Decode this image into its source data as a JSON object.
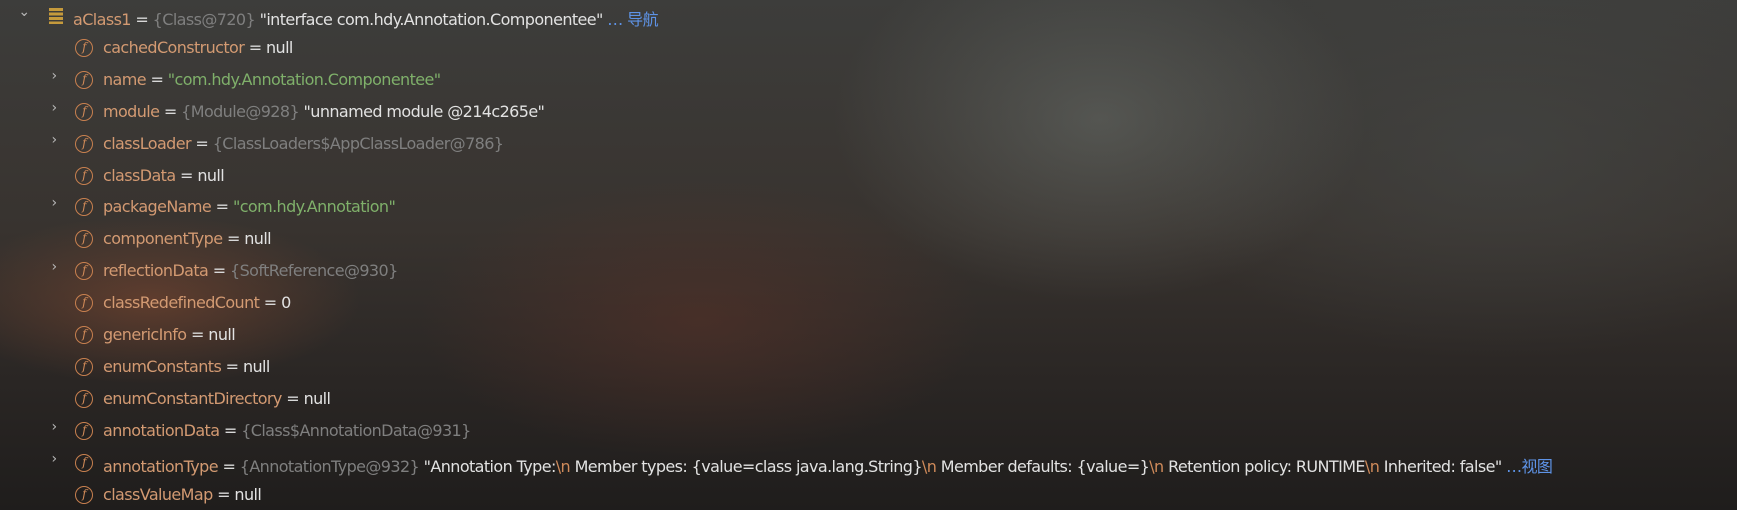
{
  "root": {
    "name": "aClass1",
    "type_ref": "{Class@720}",
    "value": "\"interface com.hdy.Annotation.Componentee\"",
    "link": "… 导航",
    "expanded": true,
    "icon": "static-field-stack-icon"
  },
  "fields": [
    {
      "name": "cachedConstructor",
      "expandable": false,
      "segments": [
        {
          "k": "plain",
          "t": "null"
        }
      ]
    },
    {
      "name": "name",
      "expandable": true,
      "segments": [
        {
          "k": "str",
          "t": "\"com.hdy.Annotation.Componentee\""
        }
      ]
    },
    {
      "name": "module",
      "expandable": true,
      "segments": [
        {
          "k": "ref",
          "t": "{Module@928}"
        },
        {
          "k": "plain",
          "t": " \"unnamed module @214c265e\""
        }
      ]
    },
    {
      "name": "classLoader",
      "expandable": true,
      "segments": [
        {
          "k": "ref",
          "t": "{ClassLoaders$AppClassLoader@786}"
        }
      ]
    },
    {
      "name": "classData",
      "expandable": false,
      "segments": [
        {
          "k": "plain",
          "t": "null"
        }
      ]
    },
    {
      "name": "packageName",
      "expandable": true,
      "segments": [
        {
          "k": "str",
          "t": "\"com.hdy.Annotation\""
        }
      ]
    },
    {
      "name": "componentType",
      "expandable": false,
      "segments": [
        {
          "k": "plain",
          "t": "null"
        }
      ]
    },
    {
      "name": "reflectionData",
      "expandable": true,
      "segments": [
        {
          "k": "ref",
          "t": "{SoftReference@930}"
        }
      ]
    },
    {
      "name": "classRedefinedCount",
      "expandable": false,
      "segments": [
        {
          "k": "plain",
          "t": "0"
        }
      ]
    },
    {
      "name": "genericInfo",
      "expandable": false,
      "segments": [
        {
          "k": "plain",
          "t": "null"
        }
      ]
    },
    {
      "name": "enumConstants",
      "expandable": false,
      "segments": [
        {
          "k": "plain",
          "t": "null"
        }
      ]
    },
    {
      "name": "enumConstantDirectory",
      "expandable": false,
      "segments": [
        {
          "k": "plain",
          "t": "null"
        }
      ]
    },
    {
      "name": "annotationData",
      "expandable": true,
      "segments": [
        {
          "k": "ref",
          "t": "{Class$AnnotationData@931}"
        }
      ]
    },
    {
      "name": "annotationType",
      "expandable": true,
      "segments": [
        {
          "k": "ref",
          "t": "{AnnotationType@932}"
        },
        {
          "k": "plain",
          "t": " \"Annotation Type:"
        },
        {
          "k": "esc",
          "t": "\\n"
        },
        {
          "k": "plain",
          "t": "   Member types: {value=class java.lang.String}"
        },
        {
          "k": "esc",
          "t": "\\n"
        },
        {
          "k": "plain",
          "t": "   Member defaults: {value=}"
        },
        {
          "k": "esc",
          "t": "\\n"
        },
        {
          "k": "plain",
          "t": "   Retention policy: RUNTIME"
        },
        {
          "k": "esc",
          "t": "\\n"
        },
        {
          "k": "plain",
          "t": "   Inherited: false\""
        },
        {
          "k": "link",
          "t": " …视图"
        }
      ]
    },
    {
      "name": "classValueMap",
      "expandable": false,
      "segments": [
        {
          "k": "plain",
          "t": "null"
        }
      ]
    }
  ],
  "field_icon_letter": "f",
  "equals": " = ",
  "arrow_collapsed": "›",
  "arrow_expanded": "⌄"
}
